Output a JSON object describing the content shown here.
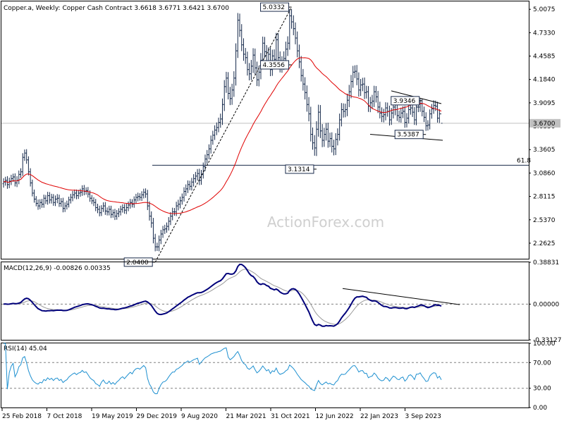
{
  "chart_data": [
    {
      "type": "bar",
      "title": "Copper.a, Weekly:  Copper Cash Contract  3.6618 3.6771 3.6421 3.6700",
      "symbol": "Copper.a",
      "timeframe": "Weekly",
      "instrument": "Copper Cash Contract",
      "ohlc": {
        "open": 3.6618,
        "high": 3.6771,
        "low": 3.6421,
        "close": 3.67
      },
      "current_price": 3.67,
      "current_price_label": "3.6700",
      "ylim": [
        2.08,
        5.1
      ],
      "y_ticks": [
        "5.0075",
        "4.7330",
        "4.4585",
        "4.1840",
        "3.9095",
        "3.6350",
        "3.3605",
        "3.0860",
        "2.8115",
        "2.5370",
        "2.2625"
      ],
      "x_ticks": [
        "25 Feb 2018",
        "7 Oct 2018",
        "19 May 2019",
        "29 Dec 2019",
        "9 Aug 2020",
        "21 Mar 2021",
        "31 Oct 2021",
        "12 Jun 2022",
        "22 Jan 2023",
        "3 Sep 2023"
      ],
      "weekly_close": [
        2.98,
        3.0,
        2.95,
        2.99,
        3.02,
        3.04,
        2.97,
        3.0,
        3.07,
        3.1,
        3.27,
        3.32,
        3.24,
        3.1,
        2.97,
        2.85,
        2.78,
        2.73,
        2.7,
        2.74,
        2.72,
        2.79,
        2.76,
        2.82,
        2.77,
        2.8,
        2.74,
        2.78,
        2.79,
        2.73,
        2.75,
        2.67,
        2.7,
        2.72,
        2.77,
        2.8,
        2.83,
        2.85,
        2.82,
        2.85,
        2.86,
        2.9,
        2.87,
        2.88,
        2.84,
        2.79,
        2.76,
        2.74,
        2.68,
        2.66,
        2.62,
        2.67,
        2.7,
        2.64,
        2.63,
        2.66,
        2.6,
        2.62,
        2.58,
        2.61,
        2.63,
        2.66,
        2.68,
        2.65,
        2.68,
        2.71,
        2.74,
        2.72,
        2.77,
        2.8,
        2.81,
        2.8,
        2.83,
        2.86,
        2.84,
        2.7,
        2.58,
        2.5,
        2.32,
        2.22,
        2.22,
        2.3,
        2.37,
        2.42,
        2.43,
        2.46,
        2.52,
        2.58,
        2.63,
        2.63,
        2.7,
        2.72,
        2.76,
        2.8,
        2.87,
        2.9,
        2.95,
        2.93,
        2.98,
        3.02,
        3.05,
        3.08,
        3.0,
        3.07,
        3.16,
        3.25,
        3.3,
        3.37,
        3.47,
        3.53,
        3.59,
        3.62,
        3.68,
        3.72,
        3.89,
        4.1,
        4.2,
        4.02,
        3.96,
        4.06,
        4.2,
        4.52,
        4.88,
        4.76,
        4.59,
        4.48,
        4.44,
        4.3,
        4.25,
        4.34,
        4.47,
        4.32,
        4.18,
        4.27,
        4.41,
        4.61,
        4.51,
        4.4,
        4.48,
        4.3,
        4.46,
        4.42,
        4.65,
        4.44,
        4.34,
        4.38,
        4.43,
        4.54,
        4.61,
        4.93,
        4.86,
        4.78,
        4.67,
        4.52,
        4.39,
        4.23,
        4.13,
        4.03,
        3.89,
        3.78,
        3.54,
        3.44,
        3.38,
        3.6,
        3.8,
        3.58,
        3.47,
        3.54,
        3.6,
        3.46,
        3.49,
        3.4,
        3.37,
        3.48,
        3.54,
        3.71,
        3.83,
        3.81,
        3.83,
        3.94,
        4.04,
        4.16,
        4.27,
        4.28,
        4.19,
        4.06,
        4.12,
        4.13,
        4.03,
        4.04,
        3.87,
        3.91,
        3.93,
        4.04,
        3.98,
        3.86,
        3.79,
        3.75,
        3.77,
        3.85,
        3.81,
        3.71,
        3.79,
        3.86,
        3.83,
        3.76,
        3.74,
        3.79,
        3.81,
        3.68,
        3.73,
        3.83,
        3.85,
        3.8,
        3.71,
        3.86,
        3.86,
        3.9,
        3.81,
        3.74,
        3.64,
        3.65,
        3.78,
        3.84,
        3.88,
        3.87,
        3.73,
        3.78,
        3.67
      ],
      "weekly_range": [
        0.13,
        0.12,
        0.14,
        0.12,
        0.13,
        0.11,
        0.12,
        0.14,
        0.13,
        0.12,
        0.14,
        0.12,
        0.13,
        0.12,
        0.12,
        0.11,
        0.12,
        0.1,
        0.13,
        0.11,
        0.12,
        0.12,
        0.11,
        0.13,
        0.12,
        0.12,
        0.11,
        0.12,
        0.14,
        0.12,
        0.12,
        0.13,
        0.12,
        0.12,
        0.11,
        0.12,
        0.13,
        0.12,
        0.12,
        0.11,
        0.12,
        0.12,
        0.13,
        0.11,
        0.12,
        0.12,
        0.11,
        0.12,
        0.12,
        0.13,
        0.12,
        0.11,
        0.12,
        0.13,
        0.12,
        0.12,
        0.12,
        0.11,
        0.13,
        0.12,
        0.12,
        0.12,
        0.11,
        0.12,
        0.13,
        0.12,
        0.12,
        0.11,
        0.12,
        0.12,
        0.13,
        0.11,
        0.12,
        0.12,
        0.13,
        0.14,
        0.15,
        0.16,
        0.17,
        0.15,
        0.14,
        0.15,
        0.14,
        0.13,
        0.14,
        0.13,
        0.14,
        0.13,
        0.14,
        0.13,
        0.14,
        0.15,
        0.14,
        0.13,
        0.14,
        0.15,
        0.14,
        0.13,
        0.14,
        0.15,
        0.14,
        0.15,
        0.16,
        0.15,
        0.14,
        0.15,
        0.16,
        0.15,
        0.16,
        0.15,
        0.16,
        0.17,
        0.16,
        0.18,
        0.2,
        0.22,
        0.21,
        0.2,
        0.22,
        0.21,
        0.23,
        0.25,
        0.24,
        0.22,
        0.21,
        0.22,
        0.21,
        0.2,
        0.22,
        0.21,
        0.23,
        0.22,
        0.21,
        0.22,
        0.24,
        0.22,
        0.21,
        0.22,
        0.23,
        0.22,
        0.21,
        0.22,
        0.23,
        0.22,
        0.21,
        0.22,
        0.24,
        0.25,
        0.23,
        0.22,
        0.23,
        0.22,
        0.21,
        0.22,
        0.21,
        0.2,
        0.22,
        0.23,
        0.24,
        0.25,
        0.24,
        0.23,
        0.26,
        0.27,
        0.25,
        0.24,
        0.23,
        0.22,
        0.21,
        0.22,
        0.2,
        0.21,
        0.22,
        0.21,
        0.2,
        0.21,
        0.22,
        0.21,
        0.2,
        0.22,
        0.23,
        0.22,
        0.21,
        0.2,
        0.21,
        0.22,
        0.2,
        0.21,
        0.22,
        0.2,
        0.19,
        0.2,
        0.21,
        0.2,
        0.19,
        0.2,
        0.18,
        0.19,
        0.2,
        0.19,
        0.18,
        0.19,
        0.17,
        0.18,
        0.19,
        0.18,
        0.17,
        0.18,
        0.17,
        0.18,
        0.17,
        0.18,
        0.17,
        0.16,
        0.17,
        0.18,
        0.17,
        0.16,
        0.17,
        0.16,
        0.17,
        0.16,
        0.15,
        0.16,
        0.17,
        0.16,
        0.15,
        0.16
      ],
      "moving_average": {
        "period_weeks": 40,
        "color": "#e00000"
      },
      "annotations": [
        {
          "label": "5.0332",
          "price": 5.0332,
          "kind": "swing-high"
        },
        {
          "label": "2.0400",
          "price": 2.04,
          "kind": "swing-low"
        },
        {
          "label": "4.3556",
          "price": 4.3556,
          "kind": "swing-high"
        },
        {
          "label": "3.1314",
          "price": 3.1314,
          "kind": "swing-low"
        },
        {
          "label": "3.9346",
          "price": 3.9346,
          "kind": "swing-high"
        },
        {
          "label": "3.5387",
          "price": 3.5387,
          "kind": "swing-low"
        },
        {
          "label": "61.8",
          "price": 3.1775,
          "kind": "fibonacci-retracement"
        }
      ],
      "watermark": "ActionForex.com"
    },
    {
      "type": "line",
      "title": "MACD(12,26,9) -0.00826 0.00335",
      "indicator": "MACD",
      "params": [
        12,
        26,
        9
      ],
      "macd_value": -0.00826,
      "signal_value": 0.00335,
      "ylim": [
        -0.3312,
        0.3883
      ],
      "y_ticks": [
        "0.38831",
        "0.00000",
        "-0.33127"
      ],
      "series": [
        {
          "name": "MACD",
          "color": "#00007a"
        },
        {
          "name": "Signal",
          "color": "#999999"
        }
      ]
    },
    {
      "type": "line",
      "title": "RSI(14) 45.04",
      "indicator": "RSI",
      "period": 14,
      "value": 45.04,
      "ylim": [
        0,
        100
      ],
      "y_ticks": [
        "100.00",
        "70.00",
        "30.00",
        "0.00"
      ],
      "levels": [
        70,
        30
      ],
      "series": [
        {
          "name": "RSI",
          "color": "#1e90d0"
        }
      ]
    }
  ]
}
